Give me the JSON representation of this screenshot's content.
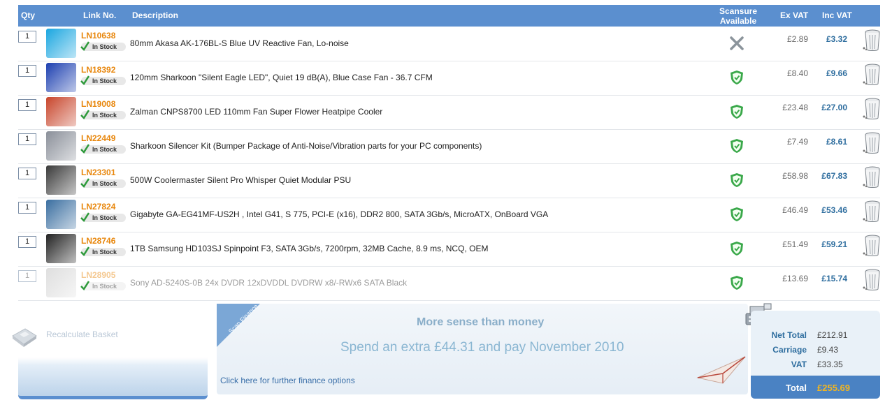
{
  "header": {
    "qty": "Qty",
    "link_no": "Link No.",
    "description": "Description",
    "scansure": "Scansure Available",
    "ex_vat": "Ex VAT",
    "inc_vat": "Inc VAT"
  },
  "stock_label": "In Stock",
  "items": [
    {
      "qty": "1",
      "link": "LN10638",
      "desc": "80mm Akasa AK-176BL-S Blue UV Reactive Fan, Lo-noise",
      "scansure": false,
      "ex": "£2.89",
      "inc": "£3.32",
      "thumb_color": "#1aa6e0"
    },
    {
      "qty": "1",
      "link": "LN18392",
      "desc": "120mm Sharkoon \"Silent Eagle LED\", Quiet 19 dB(A), Blue Case Fan - 36.7 CFM",
      "scansure": true,
      "ex": "£8.40",
      "inc": "£9.66",
      "thumb_color": "#1c3fb0"
    },
    {
      "qty": "1",
      "link": "LN19008",
      "desc": "Zalman CNPS8700 LED 110mm Fan Super Flower Heatpipe Cooler",
      "scansure": true,
      "ex": "£23.48",
      "inc": "£27.00",
      "thumb_color": "#c8452b"
    },
    {
      "qty": "1",
      "link": "LN22449",
      "desc": "Sharkoon Silencer Kit (Bumper Package of Anti-Noise/Vibration parts for your PC components)",
      "scansure": true,
      "ex": "£7.49",
      "inc": "£8.61",
      "thumb_color": "#8a8f99"
    },
    {
      "qty": "1",
      "link": "LN23301",
      "desc": "500W Coolermaster Silent Pro Whisper Quiet Modular PSU",
      "scansure": true,
      "ex": "£58.98",
      "inc": "£67.83",
      "thumb_color": "#3a3a3a"
    },
    {
      "qty": "1",
      "link": "LN27824",
      "desc": "Gigabyte GA-EG41MF-US2H , Intel G41, S 775, PCI-E (x16), DDR2 800, SATA 3Gb/s, MicroATX, OnBoard VGA",
      "scansure": true,
      "ex": "£46.49",
      "inc": "£53.46",
      "thumb_color": "#3a6ea0"
    },
    {
      "qty": "1",
      "link": "LN28746",
      "desc": "1TB Samsung HD103SJ Spinpoint F3, SATA 3Gb/s, 7200rpm, 32MB Cache, 8.9 ms, NCQ, OEM",
      "scansure": true,
      "ex": "£51.49",
      "inc": "£59.21",
      "thumb_color": "#222222"
    },
    {
      "qty": "1",
      "link": "LN28905",
      "desc": "Sony AD-5240S-0B 24x DVDR 12xDVDDL DVDRW x8/-RWx6 SATA Black",
      "scansure": true,
      "ex": "£13.69",
      "inc": "£15.74",
      "thumb_color": "#c9c9c9",
      "faded": true
    }
  ],
  "recalculate": "Recalculate Basket",
  "finance": {
    "corner": "Scan Finance",
    "headline": "More sense than money",
    "offer": "Spend an extra £44.31 and pay November 2010",
    "link": "Click here for further finance options"
  },
  "totals": {
    "net_label": "Net Total",
    "net": "£212.91",
    "carriage_label": "Carriage",
    "carriage": "£9.43",
    "vat_label": "VAT",
    "vat": "£33.35",
    "total_label": "Total",
    "total": "£255.69"
  },
  "colors": {
    "header": "#5b8fcf",
    "link": "#e8860b",
    "inc": "#2f6e9f",
    "shield": "#3aa84a",
    "total": "#f2b51f"
  }
}
